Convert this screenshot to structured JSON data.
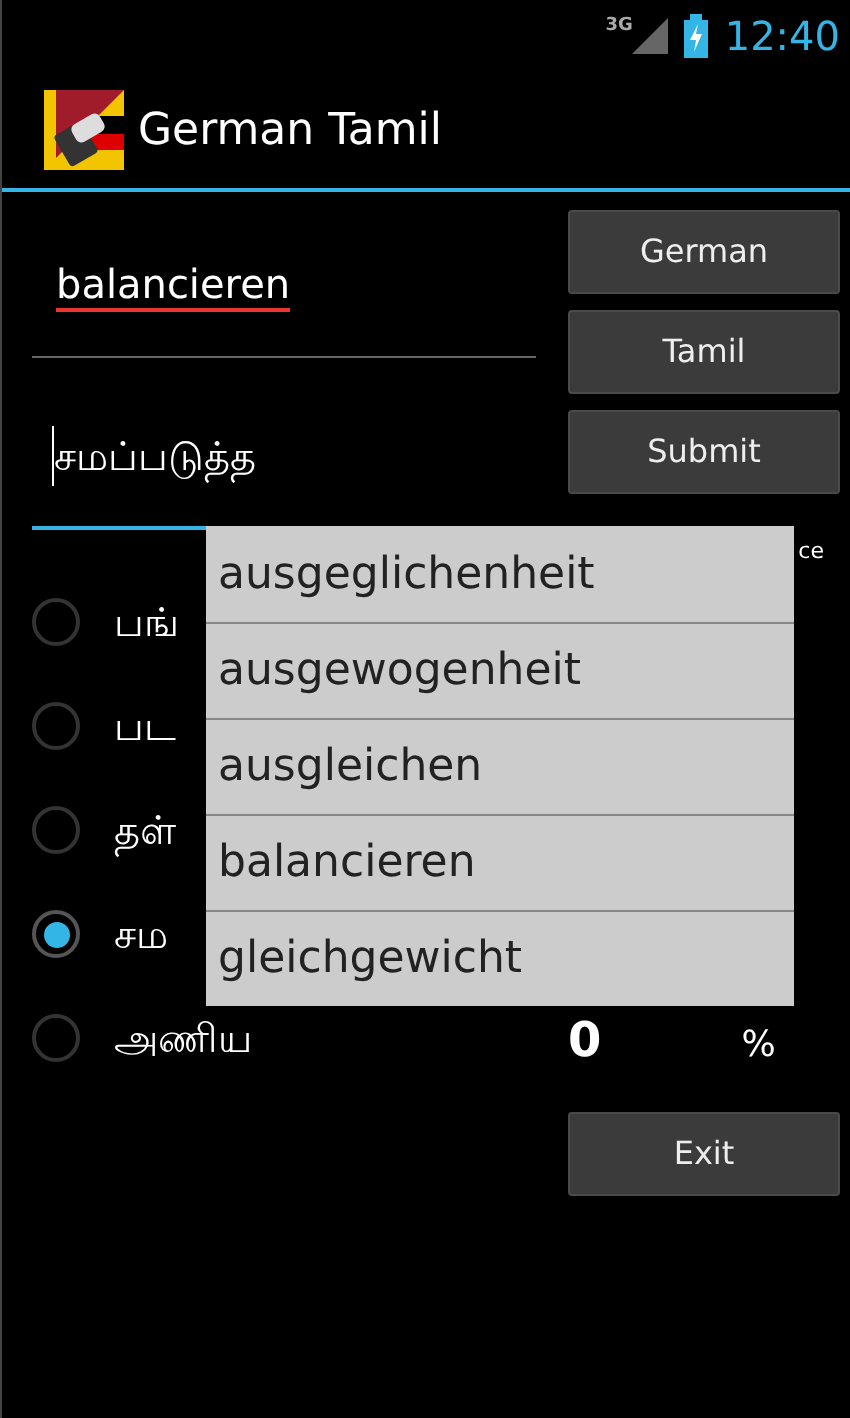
{
  "status_bar": {
    "network": "3G",
    "time": "12:40"
  },
  "action_bar": {
    "title": "German Tamil"
  },
  "german_field": {
    "value": "balancieren"
  },
  "tamil_field": {
    "value": "சமப்படுத்த",
    "focused": true
  },
  "buttons": [
    {
      "label": "German"
    },
    {
      "label": "Tamil"
    },
    {
      "label": "Submit"
    }
  ],
  "options": [
    {
      "label": "பங்",
      "selected": false
    },
    {
      "label": "பட",
      "selected": false
    },
    {
      "label": "தள்",
      "selected": false
    },
    {
      "label": "சம",
      "selected": true
    },
    {
      "label": "அணிய",
      "selected": false
    }
  ],
  "score": {
    "label_fragment": "ce",
    "value": "0",
    "unit": "%"
  },
  "exit_button": {
    "label": "Exit"
  },
  "suggestions": [
    "ausgeglichenheit",
    "ausgewogenheit",
    "ausgleichen",
    "balancieren",
    "gleichgewicht"
  ]
}
